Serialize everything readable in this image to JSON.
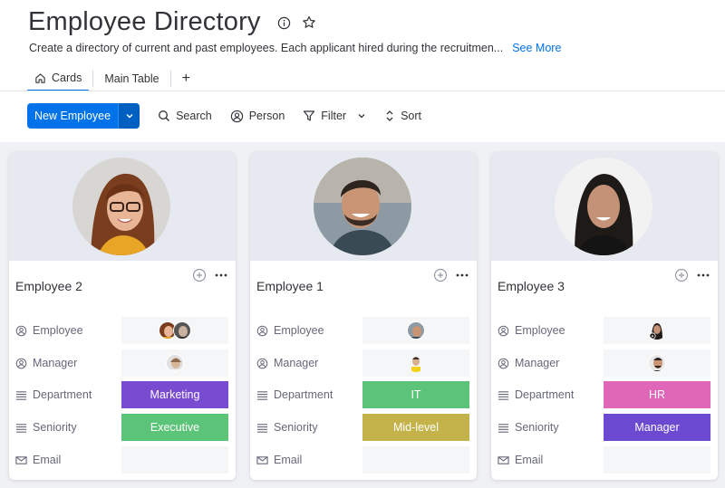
{
  "header": {
    "title": "Employee Directory",
    "description": "Create a directory of current and past employees. Each applicant hired during the recruitmen...",
    "see_more": "See More"
  },
  "tabs": [
    {
      "label": "Cards",
      "icon": "home-icon",
      "active": true
    },
    {
      "label": "Main Table",
      "active": false
    }
  ],
  "tab_add": "+",
  "toolbar": {
    "new_button": "New Employee",
    "search": "Search",
    "person": "Person",
    "filter": "Filter",
    "sort": "Sort"
  },
  "field_labels": {
    "employee": "Employee",
    "manager": "Manager",
    "department": "Department",
    "seniority": "Seniority",
    "email": "Email"
  },
  "cards": [
    {
      "name": "Employee 2",
      "department": "Marketing",
      "department_color": "#784bd1",
      "seniority": "Executive",
      "seniority_color": "#5cc478",
      "email": ""
    },
    {
      "name": "Employee 1",
      "department": "IT",
      "department_color": "#5cc478",
      "seniority": "Mid-level",
      "seniority_color": "#c4b24b",
      "email": ""
    },
    {
      "name": "Employee 3",
      "department": "HR",
      "department_color": "#e066b8",
      "seniority": "Manager",
      "seniority_color": "#6b49d1",
      "email": ""
    }
  ]
}
